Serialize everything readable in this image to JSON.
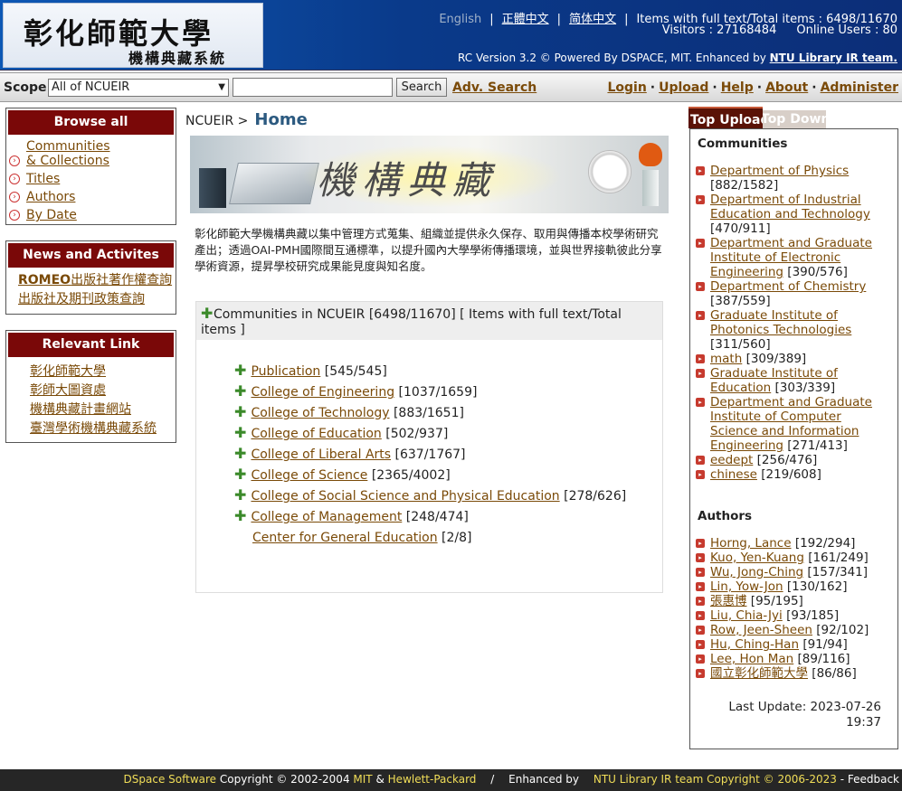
{
  "header": {
    "logo_title": "彰化師範大學",
    "logo_subtitle": "機構典藏系統",
    "lang_english": "English",
    "lang_traditional": "正體中文",
    "lang_simplified": "简体中文",
    "items_stat": "Items with full text/Total items : 6498/11670",
    "visitors": "Visitors : 27168484",
    "online_users": "Online Users : 80",
    "powered_prefix": "RC Version 3.2 © Powered By DSPACE, MIT. Enhanced by",
    "powered_link": "NTU Library IR team."
  },
  "toolbar": {
    "scope_label": "Scope",
    "scope_value": "All of NCUEIR",
    "search_value": "",
    "search_button": "Search",
    "adv_search": "Adv. Search",
    "links": [
      "Login",
      "Upload",
      "Help",
      "About",
      "Administer"
    ]
  },
  "browse": {
    "title": "Browse all",
    "items": [
      "Communities",
      "& Collections",
      "Titles",
      "Authors",
      "By Date"
    ]
  },
  "news": {
    "title": "News and Activites",
    "item1_bold": "ROMEO",
    "item1_rest": "出版社著作權查詢",
    "item2": "出版社及期刊政策查詢"
  },
  "relevant": {
    "title": "Relevant Link",
    "items": [
      "彰化師範大學",
      "彰師大圖資處",
      "機構典藏計畫網站",
      "臺灣學術機構典藏系統"
    ]
  },
  "breadcrumb": {
    "root": "NCUEIR >",
    "current": "Home"
  },
  "banner": {
    "text": "機構典藏"
  },
  "intro": "彰化師範大學機構典藏以集中管理方式蒐集、組織並提供永久保存、取用與傳播本校學術研究產出；透過OAI-PMH國際間互通標準，以提升國內大學學術傳播環境，並與世界接軌彼此分享學術資源，提昇學校研究成果能見度與知名度。",
  "communities": {
    "header": "Communities in NCUEIR [6498/11670] [ Items with full text/Total items ]",
    "items": [
      {
        "name": "Publication",
        "count": "[545/545]"
      },
      {
        "name": "College of Engineering",
        "count": "[1037/1659]"
      },
      {
        "name": "College of Technology",
        "count": "[883/1651]"
      },
      {
        "name": "College of Education",
        "count": "[502/937]"
      },
      {
        "name": "College of Liberal Arts",
        "count": "[637/1767]"
      },
      {
        "name": "College of Science",
        "count": "[2365/4002]"
      },
      {
        "name": "College of Social Science and Physical Education",
        "count": "[278/626]"
      },
      {
        "name": "College of Management",
        "count": "[248/474]"
      },
      {
        "name": "Center for General Education",
        "count": "[2/8]"
      }
    ]
  },
  "right": {
    "tab_upload": "Top Upload",
    "tab_download": "Top Download",
    "communities_title": "Communities",
    "communities": [
      {
        "line1": "Department of Physics",
        "line2": "",
        "line3": "",
        "line4": "",
        "count": "[882/1582]"
      },
      {
        "line1": "Department of Industrial",
        "line2": "Education and Technology",
        "line3": "",
        "line4": "",
        "count": "[470/911]"
      },
      {
        "line1": "Department and Graduate",
        "line2": "Institute of Electronic",
        "line3": "Engineering",
        "line4": "",
        "count": "[390/576]"
      },
      {
        "line1": "Department of Chemistry",
        "line2": "",
        "line3": "",
        "line4": "",
        "count": "[387/559]"
      },
      {
        "line1": "Graduate Institute of",
        "line2": "Photonics Technologies",
        "line3": "",
        "line4": "",
        "count": "[311/560]"
      },
      {
        "line1": "math",
        "line2": "",
        "line3": "",
        "line4": "",
        "count": "[309/389]"
      },
      {
        "line1": "Graduate Institute of",
        "line2": "Education",
        "line3": "",
        "line4": "",
        "count": "[303/339]"
      },
      {
        "line1": "Department and Graduate",
        "line2": "Institute of Computer",
        "line3": "Science and Information",
        "line4": "Engineering",
        "count": "[271/413]"
      },
      {
        "line1": "eedept",
        "line2": "",
        "line3": "",
        "line4": "",
        "count": "[256/476]"
      },
      {
        "line1": "chinese",
        "line2": "",
        "line3": "",
        "line4": "",
        "count": "[219/608]"
      }
    ],
    "authors_title": "Authors",
    "authors": [
      {
        "name": "Horng, Lance",
        "count": "[192/294]"
      },
      {
        "name": "Kuo, Yen-Kuang",
        "count": "[161/249]"
      },
      {
        "name": "Wu, Jong-Ching",
        "count": "[157/341]"
      },
      {
        "name": "Lin, Yow-Jon",
        "count": "[130/162]"
      },
      {
        "name": "張惠博",
        "count": "[95/195]"
      },
      {
        "name": "Liu, Chia-Jyi",
        "count": "[93/185]"
      },
      {
        "name": "Row, Jeen-Sheen",
        "count": "[92/102]"
      },
      {
        "name": "Hu, Ching-Han",
        "count": "[91/94]"
      },
      {
        "name": "Lee, Hon Man",
        "count": "[89/116]"
      },
      {
        "name": "國立彰化師範大學",
        "count": "[86/86]"
      }
    ],
    "last_update_label": "Last Update: 2023-07-26",
    "last_update_time": "19:37"
  },
  "footer": {
    "dspace": "DSpace Software",
    "copyright1": "Copyright © 2002-2004",
    "mit": "MIT",
    "amp": "&",
    "hp": "Hewlett-Packard",
    "slash": "/",
    "enhanced": "Enhanced by",
    "ntu": "NTU Library IR team",
    "copyright2": "Copyright ©",
    "years": "2006-2023",
    "feedback": "- Feedback"
  },
  "colors": {
    "header_blue": "#0a3a8a",
    "box_header": "#7a0808",
    "link": "#7a4a08",
    "footer": "#262626",
    "footer_accent": "#f1de58"
  }
}
